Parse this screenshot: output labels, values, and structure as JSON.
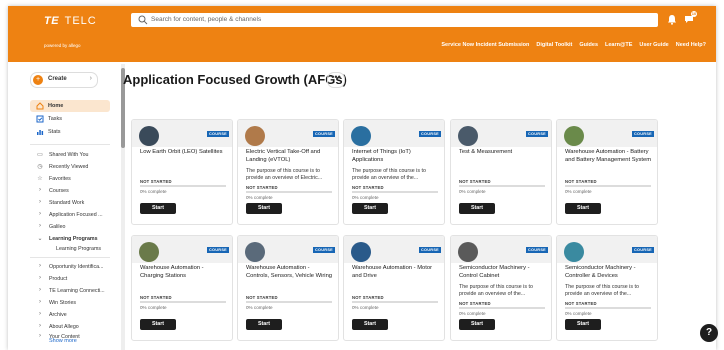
{
  "header": {
    "brand_prefix": "TE",
    "brand_name": "TELC",
    "powered_by": "powered by allego",
    "search_placeholder": "Search for content, people & channels",
    "notification_count": "10",
    "nav": [
      "Service Now Incident Submission",
      "Digital Toolkit",
      "Guides",
      "Learn@TE",
      "User Guide",
      "Need Help?"
    ]
  },
  "sidebar": {
    "create_label": "Create",
    "main": [
      {
        "label": "Home",
        "icon": "home-icon",
        "active": true
      },
      {
        "label": "Tasks",
        "icon": "tasks-icon",
        "active": false
      },
      {
        "label": "Stats",
        "icon": "stats-icon",
        "active": false
      }
    ],
    "items": [
      {
        "label": "Shared With You",
        "icon": "inbox-icon"
      },
      {
        "label": "Recently Viewed",
        "icon": "clock-icon"
      },
      {
        "label": "Favorites",
        "icon": "star-icon"
      },
      {
        "label": "Courses",
        "icon": "chevron-right-icon"
      },
      {
        "label": "Standard Work",
        "icon": "chevron-right-icon"
      },
      {
        "label": "Application Focused ...",
        "icon": "chevron-right-icon"
      },
      {
        "label": "Galileo",
        "icon": "chevron-right-icon"
      },
      {
        "label": "Learning Programs",
        "icon": "chevron-down-icon",
        "bold": true
      }
    ],
    "subitem": "Learning Programs",
    "items2": [
      {
        "label": "Opportunity Identifica...",
        "icon": "chevron-right-icon"
      },
      {
        "label": "Product",
        "icon": "chevron-right-icon"
      },
      {
        "label": "TE Learning Connecti...",
        "icon": "chevron-right-icon"
      },
      {
        "label": "Win Stories",
        "icon": "chevron-right-icon"
      },
      {
        "label": "Archive",
        "icon": "chevron-right-icon"
      },
      {
        "label": "About Allego",
        "icon": "chevron-right-icon"
      },
      {
        "label": "Your Content",
        "icon": "chevron-right-icon"
      }
    ],
    "show_more": "Show more"
  },
  "main": {
    "title": "Application Focused Growth (AFGs)",
    "more_label": "•••",
    "cards": [
      {
        "badge": "COURSE",
        "title": "Low Earth Orbit (LEO) Satellites",
        "desc": "",
        "status": "NOT STARTED",
        "progress_label": "0% complete",
        "progress": 0,
        "start": "Start",
        "image_color": "#3a4a5a"
      },
      {
        "badge": "COURSE",
        "title": "Electric Vertical Take-Off and Landing (eVTOL)",
        "desc": "The purpose of this course is to provide an overview of Electric...",
        "status": "NOT STARTED",
        "progress_label": "0% complete",
        "progress": 0,
        "start": "Start",
        "image_color": "#b07a4a"
      },
      {
        "badge": "COURSE",
        "title": "Internet of Things (IoT) Applications",
        "desc": "The purpose of this course is to provide an overview of the...",
        "status": "NOT STARTED",
        "progress_label": "0% complete",
        "progress": 0,
        "start": "Start",
        "image_color": "#2a6fa0"
      },
      {
        "badge": "COURSE",
        "title": "Test & Measurement",
        "desc": "",
        "status": "NOT STARTED",
        "progress_label": "0% complete",
        "progress": 0,
        "start": "Start",
        "image_color": "#4a5a6a"
      },
      {
        "badge": "COURSE",
        "title": "Warehouse Automation - Battery and Battery Management System",
        "desc": "",
        "status": "NOT STARTED",
        "progress_label": "0% complete",
        "progress": 0,
        "start": "Start",
        "image_color": "#6a8a4a"
      },
      {
        "badge": "COURSE",
        "title": "Warehouse Automation - Charging Stations",
        "desc": "",
        "status": "NOT STARTED",
        "progress_label": "0% complete",
        "progress": 0,
        "start": "Start",
        "image_color": "#6a7a4a"
      },
      {
        "badge": "COURSE",
        "title": "Warehouse Automation - Controls, Sensors, Vehicle Wiring",
        "desc": "",
        "status": "NOT STARTED",
        "progress_label": "0% complete",
        "progress": 0,
        "start": "Start",
        "image_color": "#5a6a7a"
      },
      {
        "badge": "COURSE",
        "title": "Warehouse Automation - Motor and Drive",
        "desc": "",
        "status": "NOT STARTED",
        "progress_label": "0% complete",
        "progress": 0,
        "start": "Start",
        "image_color": "#2a5a8a"
      },
      {
        "badge": "COURSE",
        "title": "Semiconductor Machinery - Control Cabinet",
        "desc": "The purpose of this course is to provide an overview of the...",
        "status": "NOT STARTED",
        "progress_label": "0% complete",
        "progress": 0,
        "start": "Start",
        "image_color": "#5a5a5a"
      },
      {
        "badge": "COURSE",
        "title": "Semiconductor Machinery - Controller & Devices",
        "desc": "The purpose of this course is to provide an overview of the...",
        "status": "NOT STARTED",
        "progress_label": "0% complete",
        "progress": 0,
        "start": "Start",
        "image_color": "#3a8aa0"
      }
    ]
  },
  "colors": {
    "accent": "#ee8212",
    "badge": "#1766b5",
    "button": "#1e1e1e"
  },
  "help_label": "?"
}
